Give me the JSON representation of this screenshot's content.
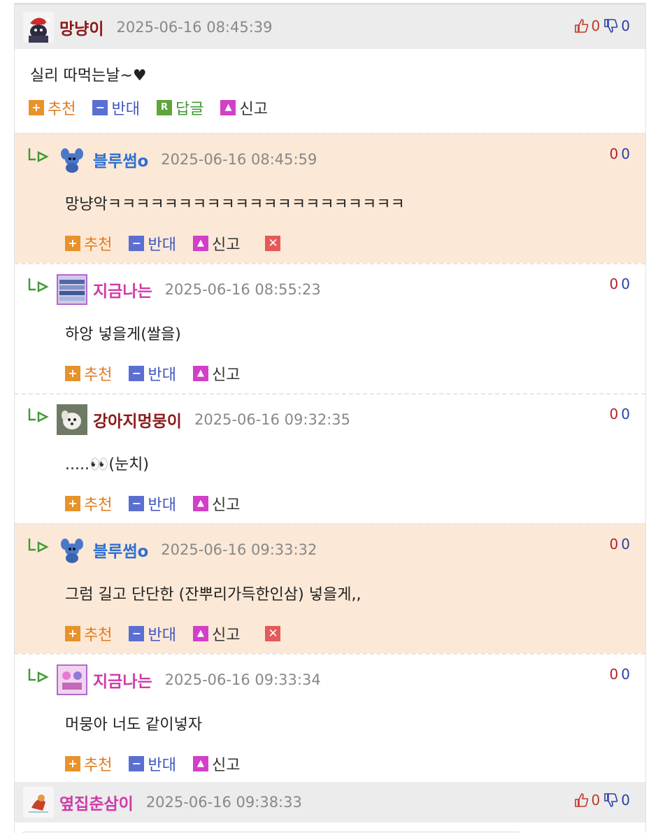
{
  "labels": {
    "up": "추천",
    "down": "반대",
    "reply": "답글",
    "report": "신고"
  },
  "colors": {
    "highlight_bg": "#fbe8d6",
    "header_bg": "#ececec",
    "nick_dark_red": "#8b1a1a",
    "nick_blue": "#2f6fd0",
    "nick_pink": "#d13aa8"
  },
  "comments": [
    {
      "nick": "망냥이",
      "date": "2025-06-16 08:45:39",
      "text": "실리 따먹는날~♥",
      "pos": "0",
      "neg": "0"
    },
    {
      "nick": "옆집춘삼이",
      "date": "2025-06-16 09:38:33",
      "pos": "0",
      "neg": "0"
    }
  ],
  "replies": [
    {
      "nick": "블루썸o",
      "date": "2025-06-16 08:45:59",
      "text": "망냥악ㅋㅋㅋㅋㅋㅋㅋㅋㅋㅋㅋㅋㅋㅋㅋㅋㅋㅋㅋㅋㅋ",
      "p": "0",
      "n": "0"
    },
    {
      "nick": "지금나는",
      "date": "2025-06-16 08:55:23",
      "text": "하앙 넣을게(쌀을)",
      "p": "0",
      "n": "0"
    },
    {
      "nick": "강아지멍뭉이",
      "date": "2025-06-16 09:32:35",
      "text": ".....👀(눈치)",
      "p": "0",
      "n": "0"
    },
    {
      "nick": "블루썸o",
      "date": "2025-06-16 09:33:32",
      "text": "그럼 길고 단단한 (잔뿌리가득한인삼) 넣을게,,",
      "p": "0",
      "n": "0"
    },
    {
      "nick": "지금나는",
      "date": "2025-06-16 09:33:34",
      "text": "머뭉아 너도 같이넣자",
      "p": "0",
      "n": "0"
    }
  ]
}
